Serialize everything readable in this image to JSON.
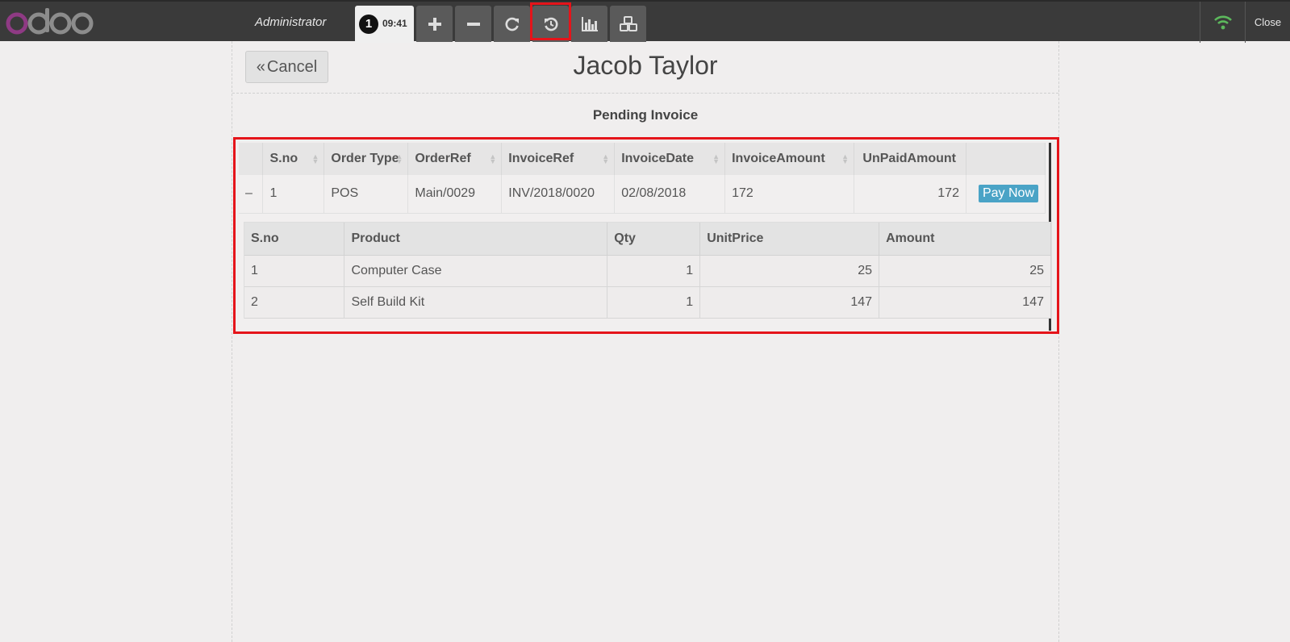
{
  "app": {
    "logo_text": "odoo",
    "user": "Administrator",
    "order_number": "1",
    "order_time": "09:41",
    "close_label": "Close",
    "toolbar_icons": [
      "plus-icon",
      "minus-icon",
      "refresh-icon",
      "history-icon",
      "chart-icon",
      "cubes-icon"
    ],
    "wifi_color": "#5cb85c"
  },
  "screen": {
    "cancel_label": "Cancel",
    "customer_name": "Jacob Taylor",
    "section_title": "Pending Invoice"
  },
  "invoice_table": {
    "headers": [
      "S.no",
      "Order Type",
      "OrderRef",
      "InvoiceRef",
      "InvoiceDate",
      "InvoiceAmount",
      "UnPaidAmount"
    ],
    "rows": [
      {
        "toggle": "–",
        "sno": "1",
        "order_type": "POS",
        "order_ref": "Main/0029",
        "invoice_ref": "INV/2018/0020",
        "invoice_date": "02/08/2018",
        "invoice_amount": "172",
        "unpaid_amount": "172",
        "action_label": "Pay Now"
      }
    ]
  },
  "detail_table": {
    "headers": [
      "S.no",
      "Product",
      "Qty",
      "UnitPrice",
      "Amount"
    ],
    "rows": [
      {
        "sno": "1",
        "product": "Computer Case",
        "qty": "1",
        "unit_price": "25",
        "amount": "25"
      },
      {
        "sno": "2",
        "product": "Self Build Kit",
        "qty": "1",
        "unit_price": "147",
        "amount": "147"
      }
    ]
  },
  "colors": {
    "highlight": "#e5141a",
    "pay_button": "#4aa3c6",
    "logo_accent": "#8f3a84"
  }
}
